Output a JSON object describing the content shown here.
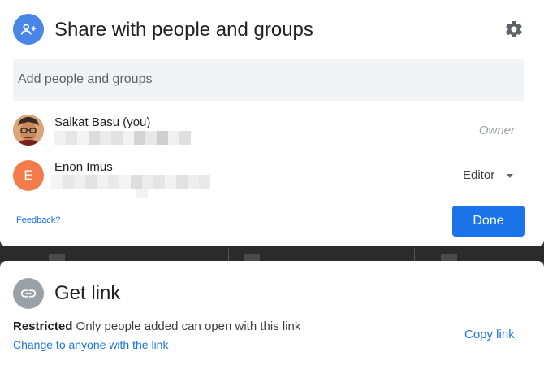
{
  "share": {
    "title": "Share with people and groups",
    "add_placeholder": "Add people and groups",
    "people": [
      {
        "name": "Saikat Basu (you)",
        "role": "Owner",
        "avatar": "photo"
      },
      {
        "name": "Enon Imus",
        "role": "Editor",
        "initial": "E",
        "avatar_color": "#f47c4c"
      }
    ],
    "feedback_label": "Feedback?",
    "done_label": "Done"
  },
  "link": {
    "title": "Get link",
    "status_bold": "Restricted",
    "status_text": "Only people added can open with this link",
    "change_label": "Change to anyone with the link",
    "copy_label": "Copy link"
  },
  "colors": {
    "accent": "#1a73e8",
    "share_icon_bg": "#4a86e8",
    "link_icon_bg": "#9aa0a6"
  },
  "icons": {
    "share": "person-add-icon",
    "settings": "gear-icon",
    "link": "link-icon",
    "role_dropdown": "caret-down-icon"
  }
}
